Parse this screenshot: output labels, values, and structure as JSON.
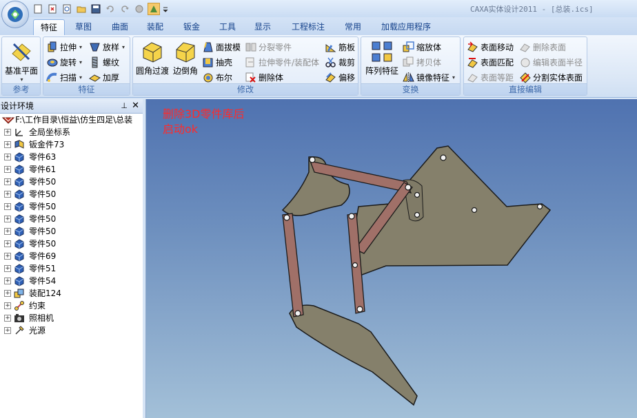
{
  "window": {
    "title": "CAXA实体设计2011 - [总装.ics]"
  },
  "quick_access": [
    "new-file",
    "open-recent",
    "reopen",
    "open-folder",
    "save",
    "undo",
    "redo",
    "render",
    "wizard-active",
    "more"
  ],
  "tabs": [
    {
      "label": "特征",
      "active": true
    },
    {
      "label": "草图"
    },
    {
      "label": "曲面"
    },
    {
      "label": "装配"
    },
    {
      "label": "钣金"
    },
    {
      "label": "工具"
    },
    {
      "label": "显示"
    },
    {
      "label": "工程标注"
    },
    {
      "label": "常用"
    },
    {
      "label": "加载应用程序"
    }
  ],
  "ribbon": {
    "groups": {
      "reference": {
        "label": "参考",
        "buttons": {
          "datum_plane": "基准平面"
        }
      },
      "feature": {
        "label": "特征",
        "buttons": {
          "extrude": "拉伸",
          "loft": "放样",
          "revolve": "旋转",
          "thread": "螺纹",
          "sweep": "扫描",
          "thicken": "加厚"
        }
      },
      "modify": {
        "label": "修改",
        "buttons": {
          "fillet": "圆角过渡",
          "chamfer": "边倒角",
          "draft": "面拔模",
          "split_part": "分裂零件",
          "rib": "筋板",
          "shell": "抽壳",
          "extrude_part": "拉伸零件/装配体",
          "trim": "裁剪",
          "boolean": "布尔",
          "delete_body": "删除体",
          "offset": "偏移"
        }
      },
      "transform": {
        "label": "变换",
        "buttons": {
          "array": "阵列特征",
          "scale": "缩放体",
          "copy_body": "拷贝体",
          "mirror": "镜像特征"
        }
      },
      "direct_edit": {
        "label": "直接编辑",
        "buttons": {
          "move_face": "表面移动",
          "delete_face": "删除表面",
          "match_face": "表面匹配",
          "edit_radius": "编辑表面半径",
          "face_equidistant": "表面等距",
          "split_solid_face": "分割实体表面"
        }
      }
    }
  },
  "design_panel": {
    "title": "设计环境",
    "pin": "⊥",
    "close": "✕",
    "root": "F:\\工作目录\\恒益\\仿生四足\\总装",
    "items": [
      {
        "label": "全局坐标系",
        "icon": "axis-icon"
      },
      {
        "label": "钣金件73",
        "icon": "sheet-metal-icon"
      },
      {
        "label": "零件63",
        "icon": "part-icon"
      },
      {
        "label": "零件61",
        "icon": "part-icon"
      },
      {
        "label": "零件50",
        "icon": "part-icon"
      },
      {
        "label": "零件50",
        "icon": "part-icon"
      },
      {
        "label": "零件50",
        "icon": "part-icon"
      },
      {
        "label": "零件50",
        "icon": "part-icon"
      },
      {
        "label": "零件50",
        "icon": "part-icon"
      },
      {
        "label": "零件50",
        "icon": "part-icon"
      },
      {
        "label": "零件69",
        "icon": "part-icon"
      },
      {
        "label": "零件51",
        "icon": "part-icon"
      },
      {
        "label": "零件54",
        "icon": "part-icon"
      },
      {
        "label": "装配124",
        "icon": "assembly-icon"
      },
      {
        "label": "约束",
        "icon": "constraint-icon"
      },
      {
        "label": "照相机",
        "icon": "camera-icon"
      },
      {
        "label": "光源",
        "icon": "light-icon"
      }
    ]
  },
  "viewport": {
    "note_line1": "删除3D零件库后",
    "note_line2": "启动ok"
  },
  "colors": {
    "plate": "#85806b",
    "link": "#a07068",
    "note": "#ff2a2a",
    "viewport_top": "#4f72b0",
    "viewport_bottom": "#a3c0d8"
  }
}
